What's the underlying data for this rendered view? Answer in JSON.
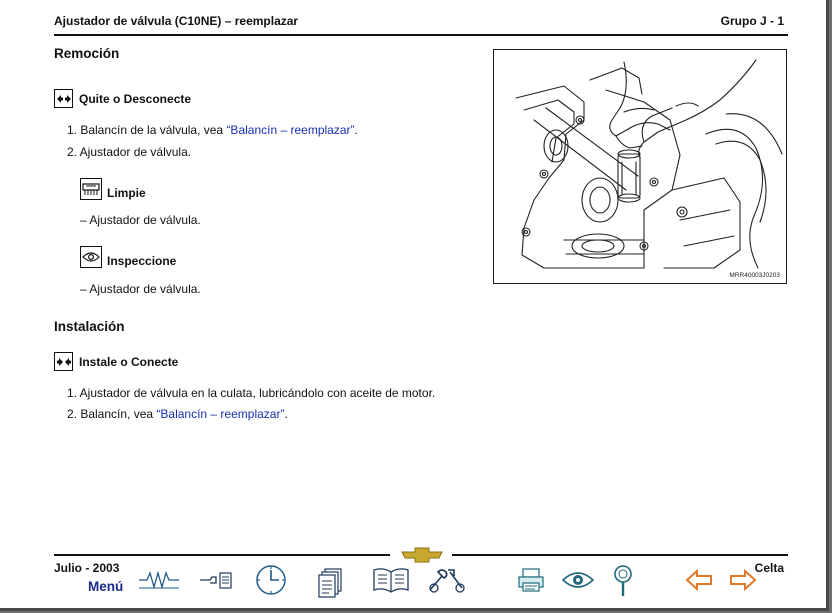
{
  "header": {
    "title": "Ajustador de válvula (C10NE) – reemplazar",
    "group": "Grupo J - 1"
  },
  "removal": {
    "heading": "Remoción",
    "action_label": "Quite o Desconecte",
    "steps": [
      {
        "prefix": "1. Balancín de la válvula, vea ",
        "link": "“Balancín – reemplazar”",
        "suffix": "."
      },
      {
        "prefix": "2. Ajustador de válvula.",
        "link": "",
        "suffix": ""
      }
    ],
    "clean_label": "Limpie",
    "clean_item": "–  Ajustador de válvula.",
    "inspect_label": "Inspeccione",
    "inspect_item": "–  Ajustador de válvula."
  },
  "figure": {
    "code": "MRR40003J0203"
  },
  "installation": {
    "heading": "Instalación",
    "action_label": "Instale o Conecte",
    "steps": [
      {
        "prefix": "1. Ajustador de válvula en la culata, lubricándolo con aceite de motor.",
        "link": "",
        "suffix": ""
      },
      {
        "prefix": "2. Balancín, vea ",
        "link": "“Balancín – reemplazar”",
        "suffix": "."
      }
    ]
  },
  "footer": {
    "date": "Julio - 2003",
    "model": "Celta",
    "menu_label": "Menú",
    "toolbar_icons": [
      "wiring-icon",
      "pointer-list-icon",
      "clock-icon",
      "pages-icon",
      "book-icon",
      "tools-icon",
      "printer-icon",
      "eye-icon",
      "magnifier-icon",
      "back-arrow-icon",
      "forward-arrow-icon"
    ],
    "colors": {
      "toolbar_blue": "#1e5a8a",
      "nav_arrow": "#e07a2a",
      "link": "#1a2fb0",
      "brand_gold": "#c9a832"
    }
  }
}
